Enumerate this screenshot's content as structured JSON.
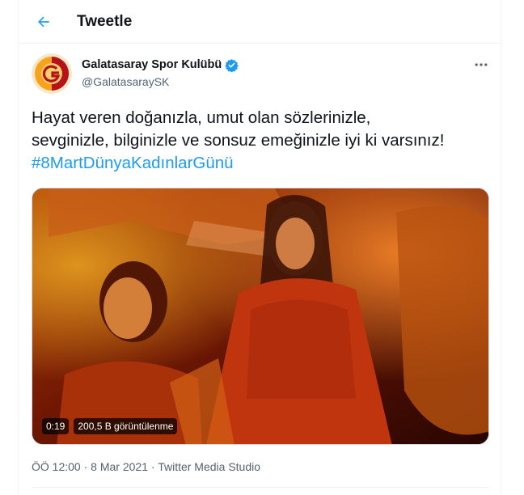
{
  "header": {
    "title": "Tweetle"
  },
  "tweet": {
    "author_name": "Galatasaray Spor Kulübü",
    "handle": "@GalatasaraySK",
    "verified": true,
    "text_lines": [
      "Hayat veren doğanızla, umut olan sözlerinizle,",
      "sevginizle, bilginizle ve sonsuz emeğinizle iyi ki varsınız!"
    ],
    "hashtag": "#8MartDünyaKadınlarGünü",
    "media": {
      "type": "video",
      "duration": "0:19",
      "views": "200,5 B görüntülenme"
    },
    "meta": {
      "time": "ÖÖ 12:00",
      "separator_1": " · ",
      "date": "8 Mar 2021",
      "separator_2": " · ",
      "source": "Twitter Media Studio"
    }
  },
  "colors": {
    "accent": "#1d9bf0",
    "secondary_text": "#536471",
    "border": "#eff3f4"
  },
  "icons": {
    "back": "arrow-left-icon",
    "verified": "verified-badge-icon",
    "more": "more-horizontal-icon"
  }
}
